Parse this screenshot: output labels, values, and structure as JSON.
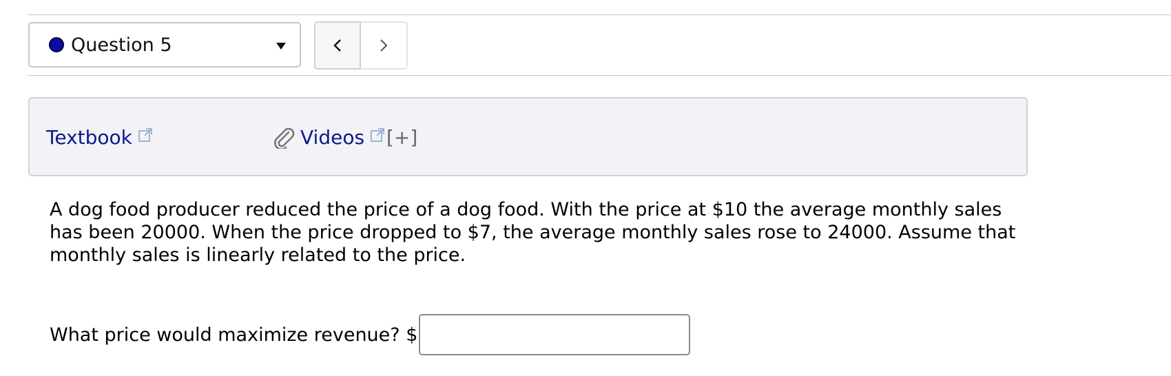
{
  "header": {
    "question_label": "Question 5",
    "status_color": "#0a0aa8"
  },
  "nav": {
    "prev_icon": "chevron-left-icon",
    "next_icon": "chevron-right-icon"
  },
  "resources": {
    "textbook_label": "Textbook",
    "videos_label": "Videos",
    "expand_label": "[+]"
  },
  "question": {
    "text": "A dog food producer reduced the price of a dog food. With the price at $10 the average monthly sales has been 20000. When the price dropped to $7, the average monthly sales rose to 24000. Assume that monthly sales is linearly related to the price.",
    "prompt": "What price would maximize revenue? $",
    "answer_value": "",
    "answer_placeholder": ""
  }
}
